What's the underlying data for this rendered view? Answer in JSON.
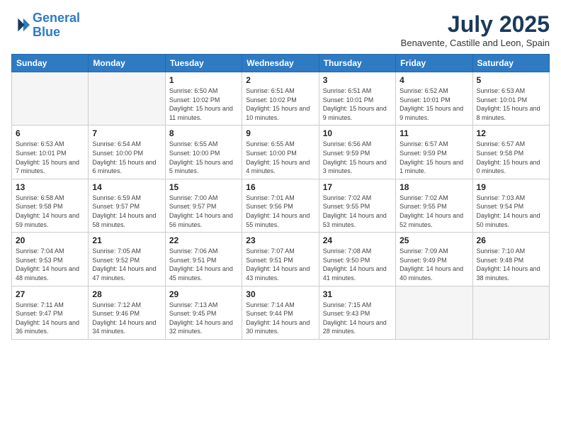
{
  "logo": {
    "line1": "General",
    "line2": "Blue"
  },
  "title": "July 2025",
  "subtitle": "Benavente, Castille and Leon, Spain",
  "weekdays": [
    "Sunday",
    "Monday",
    "Tuesday",
    "Wednesday",
    "Thursday",
    "Friday",
    "Saturday"
  ],
  "weeks": [
    [
      {
        "day": "",
        "info": ""
      },
      {
        "day": "",
        "info": ""
      },
      {
        "day": "1",
        "info": "Sunrise: 6:50 AM\nSunset: 10:02 PM\nDaylight: 15 hours and 11 minutes."
      },
      {
        "day": "2",
        "info": "Sunrise: 6:51 AM\nSunset: 10:02 PM\nDaylight: 15 hours and 10 minutes."
      },
      {
        "day": "3",
        "info": "Sunrise: 6:51 AM\nSunset: 10:01 PM\nDaylight: 15 hours and 9 minutes."
      },
      {
        "day": "4",
        "info": "Sunrise: 6:52 AM\nSunset: 10:01 PM\nDaylight: 15 hours and 9 minutes."
      },
      {
        "day": "5",
        "info": "Sunrise: 6:53 AM\nSunset: 10:01 PM\nDaylight: 15 hours and 8 minutes."
      }
    ],
    [
      {
        "day": "6",
        "info": "Sunrise: 6:53 AM\nSunset: 10:01 PM\nDaylight: 15 hours and 7 minutes."
      },
      {
        "day": "7",
        "info": "Sunrise: 6:54 AM\nSunset: 10:00 PM\nDaylight: 15 hours and 6 minutes."
      },
      {
        "day": "8",
        "info": "Sunrise: 6:55 AM\nSunset: 10:00 PM\nDaylight: 15 hours and 5 minutes."
      },
      {
        "day": "9",
        "info": "Sunrise: 6:55 AM\nSunset: 10:00 PM\nDaylight: 15 hours and 4 minutes."
      },
      {
        "day": "10",
        "info": "Sunrise: 6:56 AM\nSunset: 9:59 PM\nDaylight: 15 hours and 3 minutes."
      },
      {
        "day": "11",
        "info": "Sunrise: 6:57 AM\nSunset: 9:59 PM\nDaylight: 15 hours and 1 minute."
      },
      {
        "day": "12",
        "info": "Sunrise: 6:57 AM\nSunset: 9:58 PM\nDaylight: 15 hours and 0 minutes."
      }
    ],
    [
      {
        "day": "13",
        "info": "Sunrise: 6:58 AM\nSunset: 9:58 PM\nDaylight: 14 hours and 59 minutes."
      },
      {
        "day": "14",
        "info": "Sunrise: 6:59 AM\nSunset: 9:57 PM\nDaylight: 14 hours and 58 minutes."
      },
      {
        "day": "15",
        "info": "Sunrise: 7:00 AM\nSunset: 9:57 PM\nDaylight: 14 hours and 56 minutes."
      },
      {
        "day": "16",
        "info": "Sunrise: 7:01 AM\nSunset: 9:56 PM\nDaylight: 14 hours and 55 minutes."
      },
      {
        "day": "17",
        "info": "Sunrise: 7:02 AM\nSunset: 9:55 PM\nDaylight: 14 hours and 53 minutes."
      },
      {
        "day": "18",
        "info": "Sunrise: 7:02 AM\nSunset: 9:55 PM\nDaylight: 14 hours and 52 minutes."
      },
      {
        "day": "19",
        "info": "Sunrise: 7:03 AM\nSunset: 9:54 PM\nDaylight: 14 hours and 50 minutes."
      }
    ],
    [
      {
        "day": "20",
        "info": "Sunrise: 7:04 AM\nSunset: 9:53 PM\nDaylight: 14 hours and 48 minutes."
      },
      {
        "day": "21",
        "info": "Sunrise: 7:05 AM\nSunset: 9:52 PM\nDaylight: 14 hours and 47 minutes."
      },
      {
        "day": "22",
        "info": "Sunrise: 7:06 AM\nSunset: 9:51 PM\nDaylight: 14 hours and 45 minutes."
      },
      {
        "day": "23",
        "info": "Sunrise: 7:07 AM\nSunset: 9:51 PM\nDaylight: 14 hours and 43 minutes."
      },
      {
        "day": "24",
        "info": "Sunrise: 7:08 AM\nSunset: 9:50 PM\nDaylight: 14 hours and 41 minutes."
      },
      {
        "day": "25",
        "info": "Sunrise: 7:09 AM\nSunset: 9:49 PM\nDaylight: 14 hours and 40 minutes."
      },
      {
        "day": "26",
        "info": "Sunrise: 7:10 AM\nSunset: 9:48 PM\nDaylight: 14 hours and 38 minutes."
      }
    ],
    [
      {
        "day": "27",
        "info": "Sunrise: 7:11 AM\nSunset: 9:47 PM\nDaylight: 14 hours and 36 minutes."
      },
      {
        "day": "28",
        "info": "Sunrise: 7:12 AM\nSunset: 9:46 PM\nDaylight: 14 hours and 34 minutes."
      },
      {
        "day": "29",
        "info": "Sunrise: 7:13 AM\nSunset: 9:45 PM\nDaylight: 14 hours and 32 minutes."
      },
      {
        "day": "30",
        "info": "Sunrise: 7:14 AM\nSunset: 9:44 PM\nDaylight: 14 hours and 30 minutes."
      },
      {
        "day": "31",
        "info": "Sunrise: 7:15 AM\nSunset: 9:43 PM\nDaylight: 14 hours and 28 minutes."
      },
      {
        "day": "",
        "info": ""
      },
      {
        "day": "",
        "info": ""
      }
    ]
  ]
}
